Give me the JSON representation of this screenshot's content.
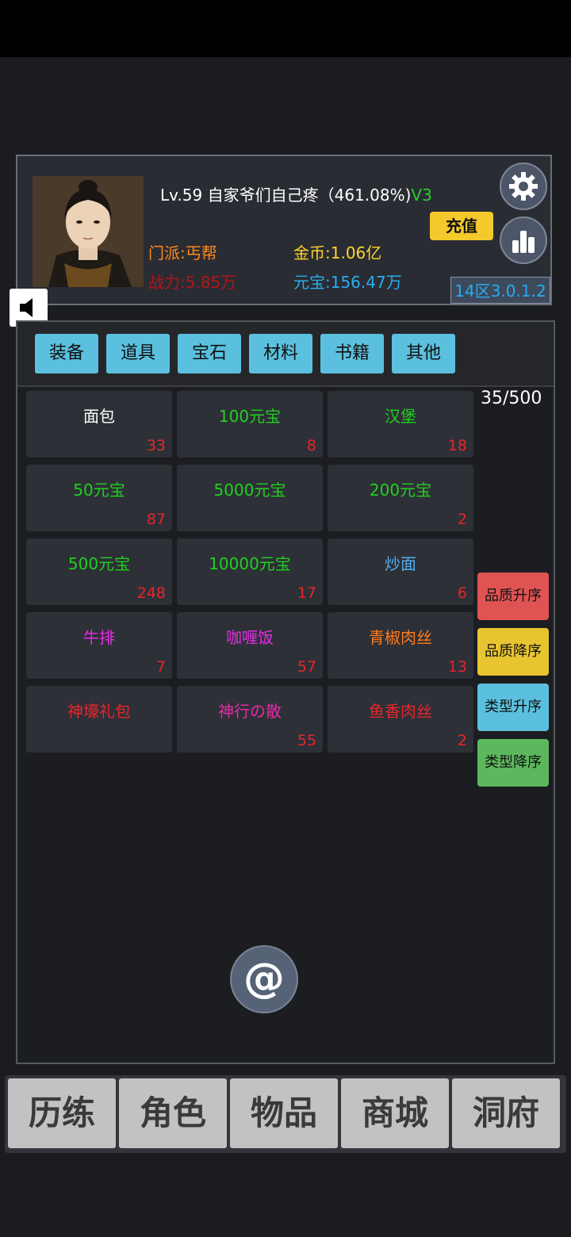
{
  "player": {
    "title_main": "Lv.59 自家爷们自己疼（461.08%)",
    "vip": "V3",
    "sect": "门派:丐帮",
    "power": "战力:5.85万",
    "gold": "金币:1.06亿",
    "ingot": "元宝:156.47万",
    "recharge_label": "充值",
    "version": "14区3.0.1.2"
  },
  "tabs": [
    "装备",
    "道具",
    "宝石",
    "材料",
    "书籍",
    "其他"
  ],
  "inventory_count": "35/500",
  "items": [
    {
      "name": "面包",
      "qty": "33",
      "color": "#ffffff"
    },
    {
      "name": "100元宝",
      "qty": "8",
      "color": "#1fd11f"
    },
    {
      "name": "汉堡",
      "qty": "18",
      "color": "#1fd11f"
    },
    {
      "name": "50元宝",
      "qty": "87",
      "color": "#1fd11f"
    },
    {
      "name": "5000元宝",
      "qty": "",
      "color": "#1fd11f"
    },
    {
      "name": "200元宝",
      "qty": "2",
      "color": "#1fd11f"
    },
    {
      "name": "500元宝",
      "qty": "248",
      "color": "#1fd11f"
    },
    {
      "name": "10000元宝",
      "qty": "17",
      "color": "#1fd11f"
    },
    {
      "name": "炒面",
      "qty": "6",
      "color": "#4fb0f0"
    },
    {
      "name": "牛排",
      "qty": "7",
      "color": "#e62ce6"
    },
    {
      "name": "咖喱饭",
      "qty": "57",
      "color": "#e62ce6"
    },
    {
      "name": "青椒肉丝",
      "qty": "13",
      "color": "#ff7a1a"
    },
    {
      "name": "神壕礼包",
      "qty": "",
      "color": "#e5262b"
    },
    {
      "name": "神行の散",
      "qty": "55",
      "color": "#e62ca8"
    },
    {
      "name": "鱼香肉丝",
      "qty": "2",
      "color": "#e5262b"
    }
  ],
  "sort_buttons": [
    {
      "label": "品质升序",
      "color": "#e05353"
    },
    {
      "label": "品质降序",
      "color": "#e8c530"
    },
    {
      "label": "类型升序",
      "color": "#5bc0de"
    },
    {
      "label": "类型降序",
      "color": "#5cb85c"
    }
  ],
  "nav": [
    "历练",
    "角色",
    "物品",
    "商城",
    "洞府"
  ],
  "icons": {
    "settings": "gear-icon",
    "ranking": "bar-chart-icon",
    "sound": "speaker-icon",
    "chat": "at-sign-icon"
  }
}
